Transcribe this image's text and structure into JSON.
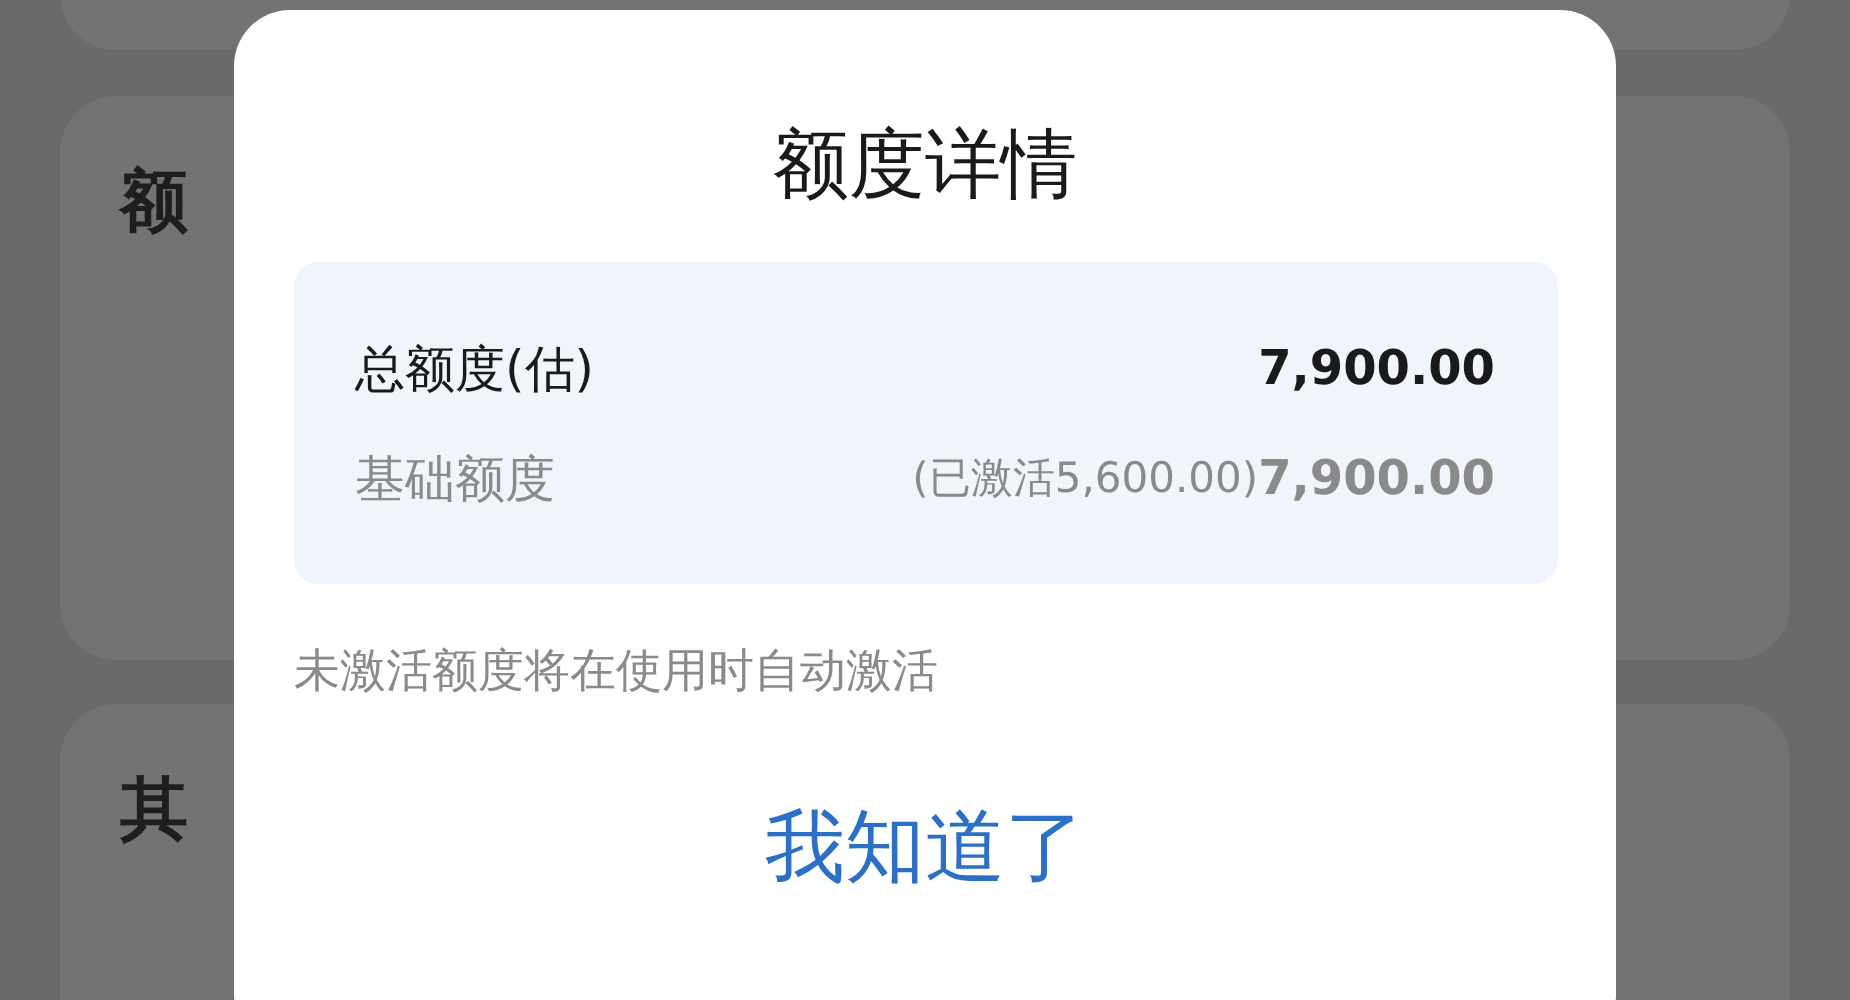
{
  "background_cards": [
    {
      "heading": "额"
    },
    {
      "heading": "其"
    }
  ],
  "dialog": {
    "title": "额度详情",
    "rows": [
      {
        "kind": "total",
        "label": "总额度(估)",
        "value": "7,900.00"
      },
      {
        "kind": "base",
        "label": "基础额度",
        "note": "(已激活5,600.00)",
        "value": "7,900.00"
      }
    ],
    "hint": "未激活额度将在使用时自动激活",
    "button": "我知道了"
  }
}
